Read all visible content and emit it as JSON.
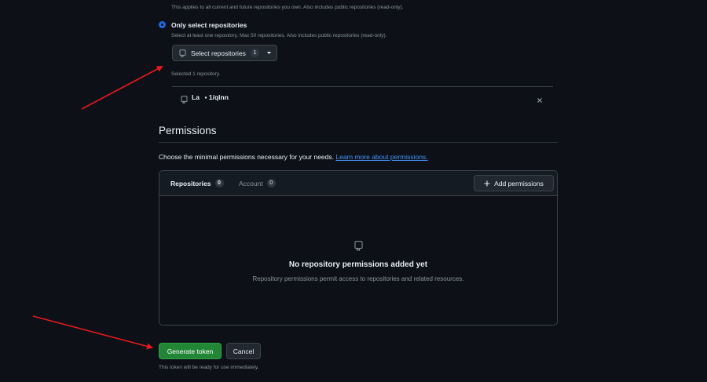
{
  "repo_access": {
    "all_repos_description": "This applies to all current and future repositories you own. Also includes public repositories (read-only).",
    "only_select": {
      "label": "Only select repositories",
      "description": "Select at least one repository. Max 50 repositories. Also includes public repositories (read-only).",
      "selected": true
    },
    "select_button": {
      "label": "Select repositories",
      "count": "1"
    },
    "selected_text": "Selected 1 repository.",
    "selected_repos": [
      {
        "name": "La  ▪ 1/qlnn"
      }
    ]
  },
  "permissions": {
    "heading": "Permissions",
    "description": "Choose the minimal permissions necessary for your needs.",
    "learn_more": "Learn more about permissions.",
    "tabs": [
      {
        "label": "Repositories",
        "count": "0",
        "active": true
      },
      {
        "label": "Account",
        "count": "0",
        "active": false
      }
    ],
    "add_button": "Add permissions",
    "empty_title": "No repository permissions added yet",
    "empty_description": "Repository permissions permit access to repositories and related resources."
  },
  "actions": {
    "generate": "Generate token",
    "cancel": "Cancel",
    "note": "This token will be ready for use immediately."
  },
  "colors": {
    "background": "#0d1117",
    "accent": "#1f6feb",
    "primary_button": "#238636",
    "annotation_arrow": "#e5191f"
  },
  "icons": [
    "repo-icon",
    "triangle-down-icon",
    "close-icon",
    "plus-icon"
  ]
}
